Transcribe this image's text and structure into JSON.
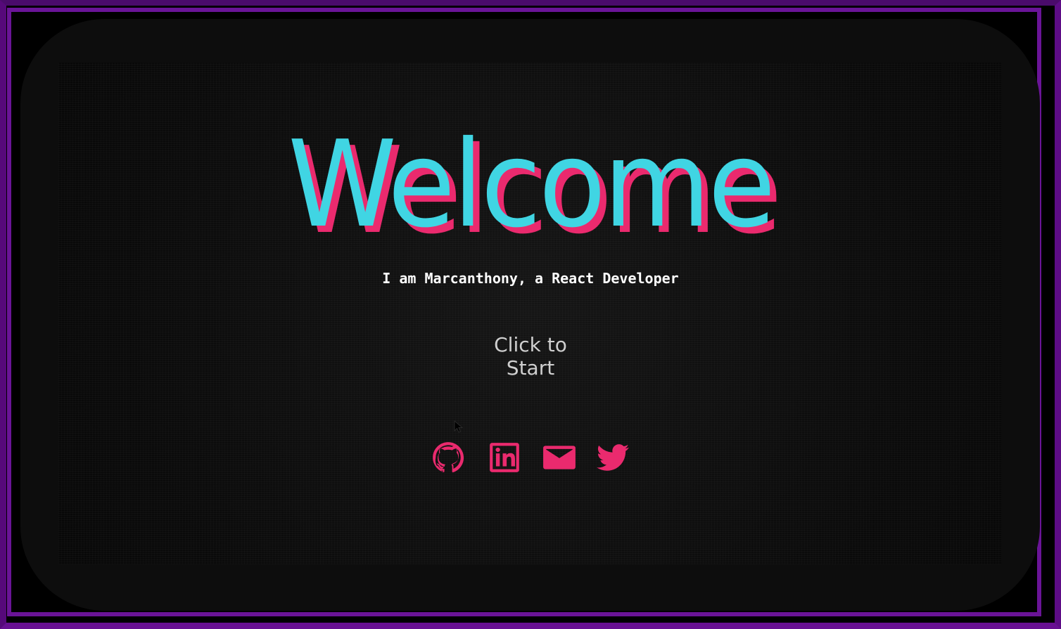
{
  "hero": {
    "title": "Welcome",
    "subtitle": "I am Marcanthony, a React Developer"
  },
  "start": {
    "label": "Click to Start"
  },
  "socials": [
    {
      "icon": "github-icon"
    },
    {
      "icon": "linkedin-icon"
    },
    {
      "icon": "email-icon"
    },
    {
      "icon": "twitter-icon"
    }
  ],
  "colors": {
    "title": "#40d5e3",
    "title_shadow": "#ea2a6e",
    "icon": "#ea2a6e",
    "frame": "#5d0c86",
    "screen": "#0d0d0d"
  }
}
